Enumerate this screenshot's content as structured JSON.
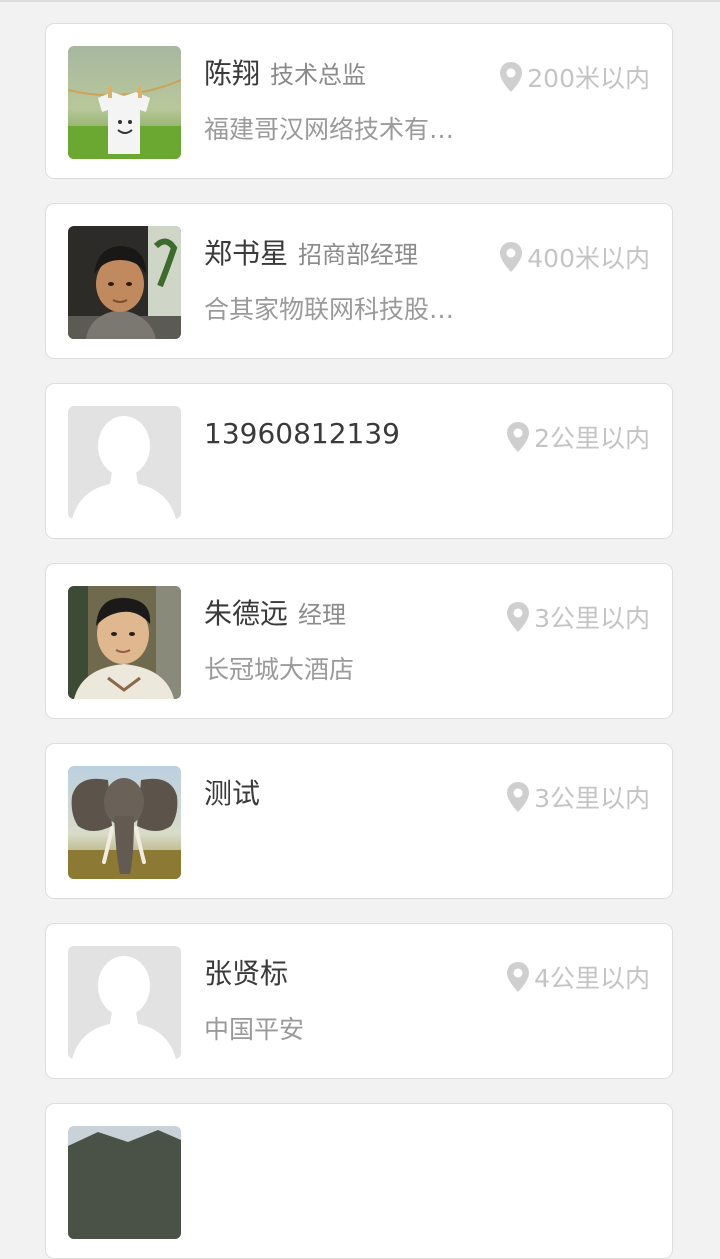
{
  "contacts": [
    {
      "name": "陈翔",
      "title": "技术总监",
      "company": "福建哥汉网络技术有…",
      "distance": "200米以内",
      "avatar": "laundry-tshirt-photo"
    },
    {
      "name": "郑书星",
      "title": "招商部经理",
      "company": "合其家物联网科技股…",
      "distance": "400米以内",
      "avatar": "man-portrait-photo"
    },
    {
      "name": "13960812139",
      "title": "",
      "company": "",
      "distance": "2公里以内",
      "avatar": "default-silhouette"
    },
    {
      "name": "朱德远",
      "title": "经理",
      "company": "长冠城大酒店",
      "distance": "3公里以内",
      "avatar": "young-man-photo"
    },
    {
      "name": "测试",
      "title": "",
      "company": "",
      "distance": "3公里以内",
      "avatar": "elephant-photo"
    },
    {
      "name": "张贤标",
      "title": "",
      "company": "中国平安",
      "distance": "4公里以内",
      "avatar": "default-silhouette"
    }
  ],
  "colors": {
    "background": "#f2f2f2",
    "card": "#ffffff",
    "name": "#3a3a3a",
    "title": "#8a8a8a",
    "company": "#9a9a9a",
    "distance": "#c4c4c4"
  }
}
